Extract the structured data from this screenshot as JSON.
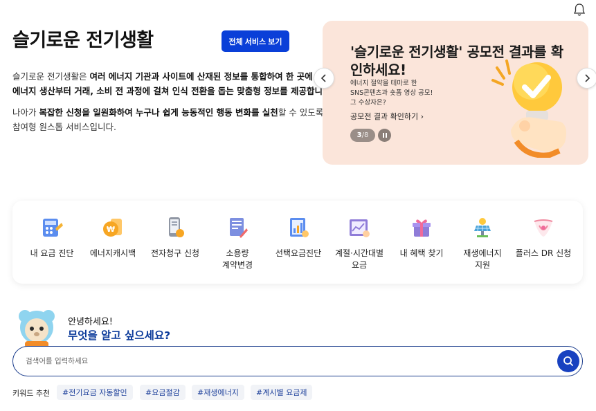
{
  "header": {
    "bell_icon": "bell-icon"
  },
  "intro": {
    "title": "슬기로운 전기생활",
    "all_services_button": "전체 서비스 보기",
    "para1_pre": "슬기로운 전기생활은 ",
    "para1_bold1": "여러 에너지 기관과 사이트에 산재된 정보를 통합하여 한 곳에",
    "para1_line2_bold": "에너지 생산부터 거래, 소비 전 과정에 걸쳐 인식 전환을 돕는 맞춤형 정보를 제공합니다.",
    "para2_pre": "나아가 ",
    "para2_bold": "복잡한 신청을 일원화하여 누구나 쉽게 능동적인 행동 변화를 실천",
    "para2_post": "할 수 있도록",
    "para2_line2": "참여형 원스톱 서비스입니다."
  },
  "banner": {
    "title": "'슬기로운 전기생활' 공모전 결과를 확인하세요!",
    "subtitle": "에너지 절약을 테마로 한\nSNS콘텐츠과 숏폼 영상 공모!\n그 수상자은?",
    "link": "공모전 결과 확인하기",
    "current": "3",
    "total": "/8",
    "colors": {
      "background": "#fbe5da",
      "bulb": "#ffc93c"
    }
  },
  "services": [
    {
      "label": "내 요금 진단",
      "icon": "calculator-icon"
    },
    {
      "label": "에너지캐시백",
      "icon": "coin-cashback-icon"
    },
    {
      "label": "전자청구 신청",
      "icon": "mobile-bill-icon"
    },
    {
      "label": "소용량\n계약변경",
      "icon": "contract-document-icon"
    },
    {
      "label": "선택요금진단",
      "icon": "rate-chart-icon"
    },
    {
      "label": "계절·시간대별\n요금",
      "icon": "seasonal-chart-icon"
    },
    {
      "label": "내 혜택 찾기",
      "icon": "gift-box-icon"
    },
    {
      "label": "재생에너지\n지원",
      "icon": "solar-panel-icon"
    },
    {
      "label": "플러스 DR 신청",
      "icon": "dr-heart-icon"
    }
  ],
  "assistant": {
    "greeting": "안녕하세요!",
    "question": "무엇을 알고 싶으세요?"
  },
  "search": {
    "placeholder": "검색어를 입력하세요"
  },
  "keywords": {
    "label": "키워드 추천",
    "items": [
      "#전기요금 자동할인",
      "#요금절감",
      "#재생에너지",
      "#계시별 요금제"
    ]
  },
  "colors": {
    "primary": "#0a3fd8",
    "navy": "#0b3a9a"
  }
}
